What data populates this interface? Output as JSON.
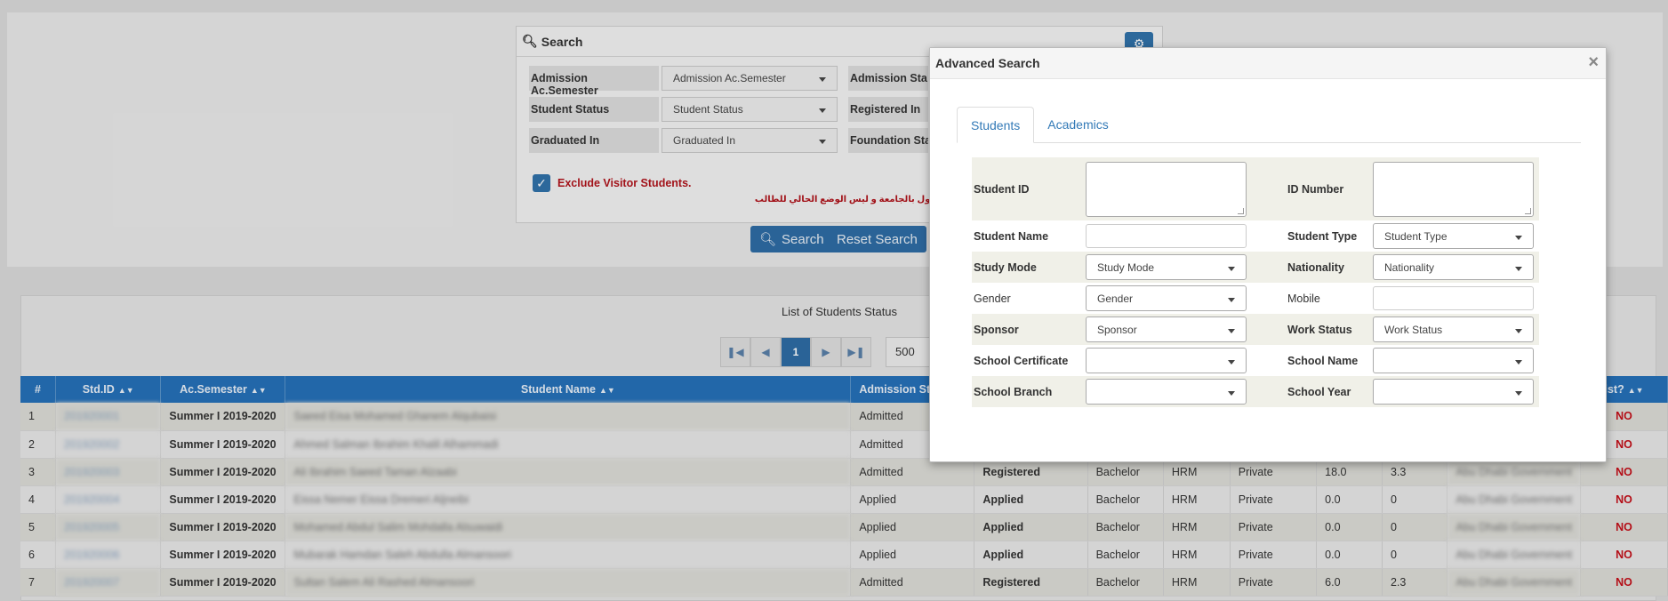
{
  "search_panel": {
    "title": "Search",
    "rows": [
      {
        "label": "Admission Ac.Semester",
        "value": "Admission Ac.Semester",
        "label2": "Admission Sta"
      },
      {
        "label": "Student Status",
        "value": "Student Status",
        "label2": "Registered In"
      },
      {
        "label": "Graduated In",
        "value": "Graduated In",
        "label2": "Foundation Sta"
      }
    ],
    "exclude_visitors_label": "Exclude Visitor Students.",
    "arabic_note": "ع اثناء فترة القبول بالجامعة و ليس الوضع الحالي للطالب",
    "search_button": "Search",
    "reset_button": "Reset Search"
  },
  "list": {
    "title": "List of Students Status",
    "current_page": "1",
    "page_size": "500",
    "columns": [
      "#",
      "Std.ID",
      "Ac.Semester",
      "Student Name",
      "Admission Status",
      "",
      "",
      "",
      "",
      "",
      "",
      "",
      "ist?"
    ],
    "rows": [
      {
        "n": "1",
        "id": "201920001",
        "sem": "Summer I 2019-2020",
        "name": "Saeed Eisa Mohamed Ghanem Alqubaisi",
        "adm": "Admitted",
        "reg": "",
        "deg": "",
        "major": "",
        "type": "",
        "h": "",
        "g": "",
        "sp": "",
        "flag": "NO"
      },
      {
        "n": "2",
        "id": "201920002",
        "sem": "Summer I 2019-2020",
        "name": "Ahmed Salman Ibrahim Khalil Alhammadi",
        "adm": "Admitted",
        "reg": "",
        "deg": "",
        "major": "",
        "type": "",
        "h": "",
        "g": "",
        "sp": "",
        "flag": "NO"
      },
      {
        "n": "3",
        "id": "201920003",
        "sem": "Summer I 2019-2020",
        "name": "Ali Ibrahim Saeed Taman Alzaabi",
        "adm": "Admitted",
        "reg": "Registered",
        "deg": "Bachelor",
        "major": "HRM",
        "type": "Private",
        "h": "18.0",
        "g": "3.3",
        "sp": "Abu Dhabi Government",
        "flag": "NO"
      },
      {
        "n": "4",
        "id": "201920004",
        "sem": "Summer I 2019-2020",
        "name": "Eissa Nemer Eissa Dremeri Aljneibi",
        "adm": "Applied",
        "reg": "Applied",
        "deg": "Bachelor",
        "major": "HRM",
        "type": "Private",
        "h": "0.0",
        "g": "0",
        "sp": "Abu Dhabi Government",
        "flag": "NO"
      },
      {
        "n": "5",
        "id": "201920005",
        "sem": "Summer I 2019-2020",
        "name": "Mohamed Abdul Salim Mohdalla Alsuwaidi",
        "adm": "Applied",
        "reg": "Applied",
        "deg": "Bachelor",
        "major": "HRM",
        "type": "Private",
        "h": "0.0",
        "g": "0",
        "sp": "Abu Dhabi Government",
        "flag": "NO"
      },
      {
        "n": "6",
        "id": "201920006",
        "sem": "Summer I 2019-2020",
        "name": "Mubarak Hamdan Saleh Abdulla Almansoori",
        "adm": "Applied",
        "reg": "Applied",
        "deg": "Bachelor",
        "major": "HRM",
        "type": "Private",
        "h": "0.0",
        "g": "0",
        "sp": "Abu Dhabi Government",
        "flag": "NO"
      },
      {
        "n": "7",
        "id": "201920007",
        "sem": "Summer I 2019-2020",
        "name": "Sultan Salem Ali Rashed Almansoori",
        "adm": "Admitted",
        "reg": "Registered",
        "deg": "Bachelor",
        "major": "HRM",
        "type": "Private",
        "h": "6.0",
        "g": "2.3",
        "sp": "Abu Dhabi Government",
        "flag": "NO"
      }
    ]
  },
  "modal": {
    "title": "Advanced Search",
    "close": "×",
    "tabs": [
      "Students",
      "Academics"
    ],
    "fields": {
      "student_id": "Student ID",
      "id_number": "ID Number",
      "student_name": "Student Name",
      "student_type": "Student Type",
      "student_type_value": "Student Type",
      "study_mode": "Study Mode",
      "study_mode_value": "Study Mode",
      "nationality": "Nationality",
      "nationality_value": "Nationality",
      "gender": "Gender",
      "gender_value": "Gender",
      "mobile": "Mobile",
      "sponsor": "Sponsor",
      "sponsor_value": "Sponsor",
      "work_status": "Work Status",
      "work_status_value": "Work Status",
      "school_certificate": "School Certificate",
      "school_name": "School Name",
      "school_branch": "School Branch",
      "school_year": "School Year"
    }
  },
  "colors": {
    "primary": "#2e6ca4",
    "header": "#2570b8",
    "danger": "#c4101a"
  }
}
